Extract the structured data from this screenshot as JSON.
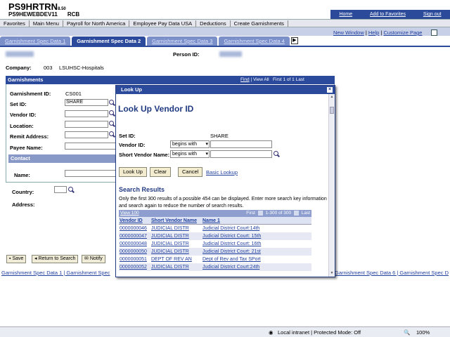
{
  "header": {
    "brand": "PS9HRTRN",
    "brand_version": "8.50",
    "db_name": "PS9HEWEBDEV11",
    "user": "RCB",
    "links": [
      "Home",
      "Add to Favorites",
      "Sign out"
    ]
  },
  "menu": {
    "items": [
      "Favorites",
      "Main Menu",
      "Payroll for North America",
      "Employee Pay Data USA",
      "Deductions",
      "Create Garnishments"
    ]
  },
  "help_links": [
    "New Window",
    "Help",
    "Customize Page"
  ],
  "tabs": [
    "Garnishment Spec Data 1",
    "Garnishment Spec Data 2",
    "Garnishment Spec Data 3",
    "Garnishment Spec Data 4"
  ],
  "page": {
    "person_id_label": "Person ID:",
    "company_label": "Company:",
    "company_code": "003",
    "company_name": "LSUHSC-Hospitals",
    "section_title": "Garnishments",
    "section_nav": {
      "find": "Find",
      "view_all": "View All",
      "first": "First",
      "count": "1 of 1",
      "last": "Last"
    },
    "fields": {
      "garnishment_id_label": "Garnishment ID:",
      "garnishment_id": "CS001",
      "set_id_label": "Set ID:",
      "set_id": "SHARE",
      "vendor_id_label": "Vendor ID:",
      "location_label": "Location:",
      "remit_address_label": "Remit Address:",
      "payee_name_label": "Payee Name:"
    },
    "contact_title": "Contact",
    "name_label": "Name:",
    "country_label": "Country:",
    "address_label": "Address:"
  },
  "buttons": {
    "save": "Save",
    "return_to_search": "Return to Search",
    "notify": "Notify"
  },
  "footer": {
    "left": "Garnishment Spec Data 1 | Garnishment Spec",
    "right": "Garnishment Spec Data 6 | Garnishment Spec D"
  },
  "modal": {
    "header": "Look Up",
    "close": "×",
    "title": "Look Up Vendor ID",
    "set_id_label": "Set ID:",
    "set_id_value": "SHARE",
    "vendor_id_label": "Vendor ID:",
    "vendor_id_operator": "begins with",
    "short_vendor_label": "Short Vendor Name:",
    "short_vendor_operator": "begins with",
    "buttons": {
      "lookup": "Look Up",
      "clear": "Clear",
      "cancel": "Cancel",
      "basic": "Basic Lookup"
    },
    "results_title": "Search Results",
    "results_msg": "Only the first 300 results of a possible 454 can be displayed. Enter more search key information and search again to reduce the number of search results.",
    "grid_view": "View 100",
    "grid_first": "First",
    "grid_range": "1-300 of 300",
    "grid_last": "Last",
    "columns": [
      "Vendor ID",
      "Short Vendor Name",
      "Name 1"
    ],
    "rows": [
      [
        "0000000046",
        "JUDICIAL DISTR",
        "Judicial District Court:14th"
      ],
      [
        "0000000047",
        "JUDICIAL DISTR",
        "Judicial District Court: 15th"
      ],
      [
        "0000000048",
        "JUDICIAL DISTR",
        "Judicial District Court: 16th"
      ],
      [
        "0000000050",
        "JUDICIAL DISTR",
        "Judicial District Court: 21st"
      ],
      [
        "0000000051",
        "DEPT OF REV AN",
        "Dept of Rev and Tax SPort"
      ],
      [
        "0000000052",
        "JUDICIAL DISTR",
        "Judicial District Court:24th"
      ]
    ]
  },
  "statusbar": {
    "zone": "Local intranet | Protected Mode: Off",
    "zoom": "100%"
  }
}
